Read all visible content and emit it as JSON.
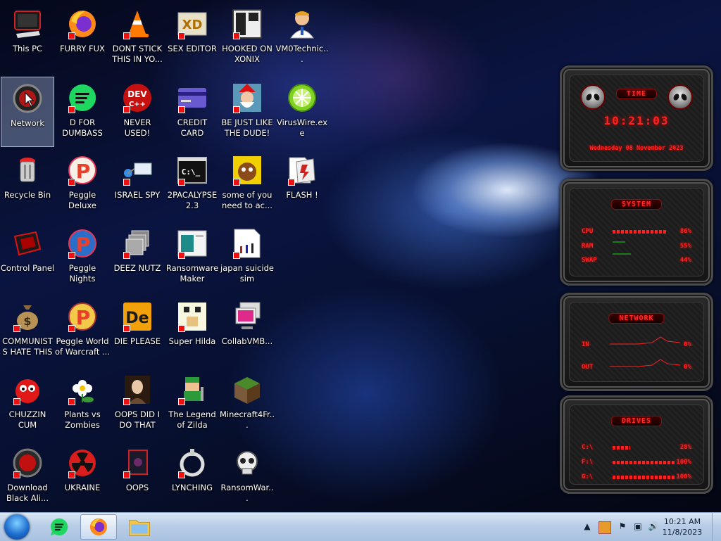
{
  "desktop": {
    "icons": [
      {
        "label": "This PC"
      },
      {
        "label": "FURRY FUX"
      },
      {
        "label": "DONT STICK THIS IN YO..."
      },
      {
        "label": "SEX EDITOR"
      },
      {
        "label": "HOOKED ON XONIX"
      },
      {
        "label": "VM0Technic..."
      },
      {
        "label": "Network"
      },
      {
        "label": "D FOR DUMBASS"
      },
      {
        "label": "NEVER USED!"
      },
      {
        "label": "CREDIT CARD CHECKER"
      },
      {
        "label": "BE JUST LIKE THE DUDE!"
      },
      {
        "label": "VirusWire.exe"
      },
      {
        "label": "Recycle Bin"
      },
      {
        "label": "Peggle Deluxe"
      },
      {
        "label": "ISRAEL SPY"
      },
      {
        "label": "2PACALYPSE 2.3"
      },
      {
        "label": "some of you need to ac..."
      },
      {
        "label": "FLASH !"
      },
      {
        "label": "Control Panel"
      },
      {
        "label": "Peggle Nights Deluxe"
      },
      {
        "label": "DEEZ NUTZ"
      },
      {
        "label": "Ransomware Maker Build..."
      },
      {
        "label": "japan suicide sim"
      },
      {
        "label": "COMMUNISTS HATE THIS G..."
      },
      {
        "label": "Peggle World of Warcraft ..."
      },
      {
        "label": "DIE PLEASE"
      },
      {
        "label": "Super Hilda"
      },
      {
        "label": "CollabVMB..."
      },
      {
        "label": "CHUZZIN CUM"
      },
      {
        "label": "Plants vs Zombies"
      },
      {
        "label": "OOPS DID I DO THAT"
      },
      {
        "label": "The Legend of Zilda"
      },
      {
        "label": "Minecraft4Fr..."
      },
      {
        "label": "Download Black Ali..."
      },
      {
        "label": "UKRAINE"
      },
      {
        "label": "OOPS"
      },
      {
        "label": "LYNCHING"
      },
      {
        "label": "RansomWar..."
      }
    ],
    "dev_icon_text": "DEV",
    "dev_icon_sub": "C++",
    "de_icon_text": "De",
    "p_letter": "P",
    "cmd_icon_text": "C:\\_",
    "xd_icon_text": "XD"
  },
  "widget": {
    "time": {
      "title": "TIME",
      "clock": "10:21:03",
      "date": "Wednesday 08 November 2023"
    },
    "system": {
      "title": "SYSTEM",
      "rows": [
        {
          "label": "CPU",
          "value": "86%",
          "level": 0.86
        },
        {
          "label": "RAM",
          "value": "55%",
          "level": 0.55
        },
        {
          "label": "SWAP",
          "value": "44%",
          "level": 0.44
        }
      ]
    },
    "network": {
      "title": "NETWORK",
      "rows": [
        {
          "label": "IN",
          "value": "0%"
        },
        {
          "label": "OUT",
          "value": "0%"
        }
      ]
    },
    "drives": {
      "title": "DRIVES",
      "rows": [
        {
          "label": "C:\\",
          "value": "28%",
          "level": 0.28
        },
        {
          "label": "F:\\",
          "value": "100%",
          "level": 1.0
        },
        {
          "label": "G:\\",
          "value": "100%",
          "level": 1.0
        }
      ]
    }
  },
  "taskbar": {
    "clock_time": "10:21 AM",
    "clock_date": "11/8/2023"
  }
}
